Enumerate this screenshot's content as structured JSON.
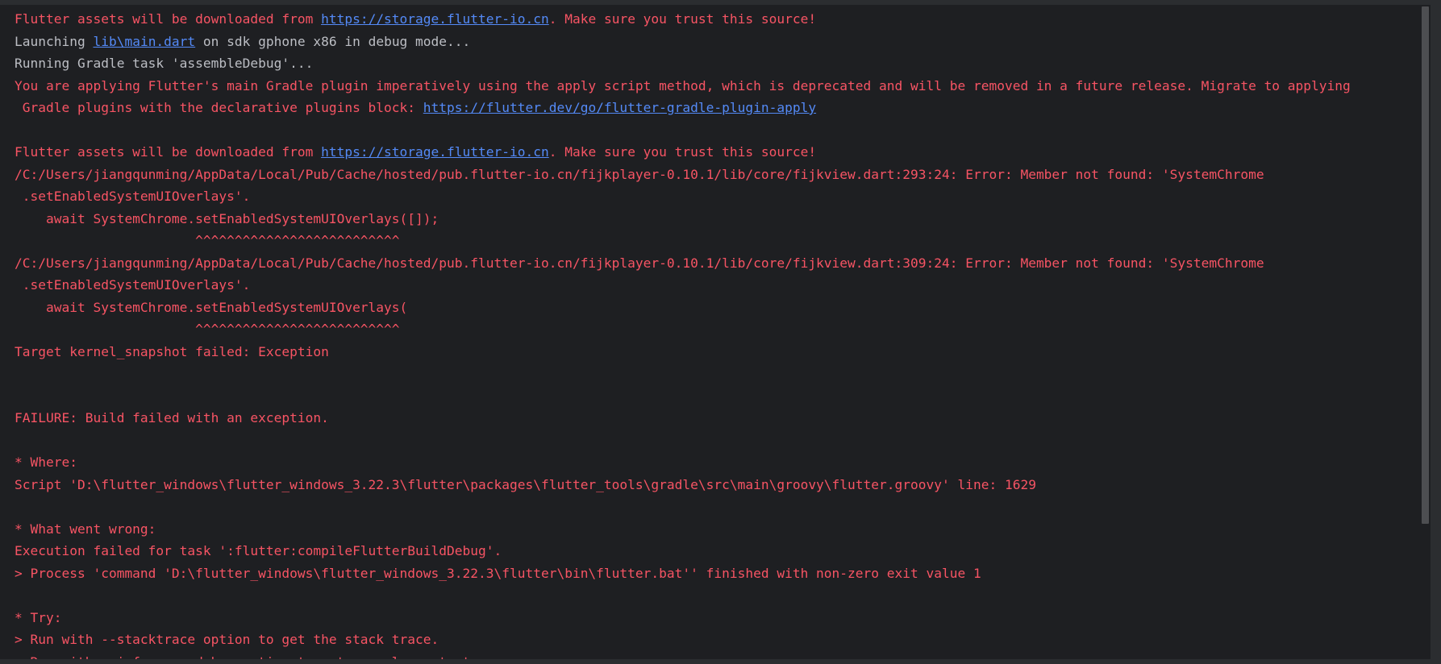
{
  "console": {
    "lines": [
      {
        "parts": [
          {
            "text": "Flutter assets will be downloaded from ",
            "style": "err"
          },
          {
            "text": "https://storage.flutter-io.cn",
            "style": "link"
          },
          {
            "text": ". Make sure you trust this source!",
            "style": "err"
          }
        ]
      },
      {
        "parts": [
          {
            "text": "Launching ",
            "style": "norm"
          },
          {
            "text": "lib\\main.dart",
            "style": "link"
          },
          {
            "text": " on sdk gphone x86 in debug mode...",
            "style": "norm"
          }
        ]
      },
      {
        "parts": [
          {
            "text": "Running Gradle task 'assembleDebug'...",
            "style": "norm"
          }
        ]
      },
      {
        "parts": [
          {
            "text": "You are applying Flutter's main Gradle plugin imperatively using the apply script method, which is deprecated and will be removed in a future release. Migrate to applying",
            "style": "err"
          }
        ]
      },
      {
        "parts": [
          {
            "text": " Gradle plugins with the declarative plugins block: ",
            "style": "err"
          },
          {
            "text": "https://flutter.dev/go/flutter-gradle-plugin-apply",
            "style": "link"
          }
        ]
      },
      {
        "parts": []
      },
      {
        "parts": [
          {
            "text": "Flutter assets will be downloaded from ",
            "style": "err"
          },
          {
            "text": "https://storage.flutter-io.cn",
            "style": "link"
          },
          {
            "text": ". Make sure you trust this source!",
            "style": "err"
          }
        ]
      },
      {
        "parts": [
          {
            "text": "/C:/Users/jiangqunming/AppData/Local/Pub/Cache/hosted/pub.flutter-io.cn/fijkplayer-0.10.1/lib/core/fijkview.dart:293:24: Error: Member not found: 'SystemChrome",
            "style": "err"
          }
        ]
      },
      {
        "parts": [
          {
            "text": " .setEnabledSystemUIOverlays'.",
            "style": "err"
          }
        ]
      },
      {
        "parts": [
          {
            "text": "    await SystemChrome.setEnabledSystemUIOverlays([]);",
            "style": "err"
          }
        ]
      },
      {
        "parts": [
          {
            "text": "                       ^^^^^^^^^^^^^^^^^^^^^^^^^^",
            "style": "err"
          }
        ]
      },
      {
        "parts": [
          {
            "text": "/C:/Users/jiangqunming/AppData/Local/Pub/Cache/hosted/pub.flutter-io.cn/fijkplayer-0.10.1/lib/core/fijkview.dart:309:24: Error: Member not found: 'SystemChrome",
            "style": "err"
          }
        ]
      },
      {
        "parts": [
          {
            "text": " .setEnabledSystemUIOverlays'.",
            "style": "err"
          }
        ]
      },
      {
        "parts": [
          {
            "text": "    await SystemChrome.setEnabledSystemUIOverlays(",
            "style": "err"
          }
        ]
      },
      {
        "parts": [
          {
            "text": "                       ^^^^^^^^^^^^^^^^^^^^^^^^^^",
            "style": "err"
          }
        ]
      },
      {
        "parts": [
          {
            "text": "Target kernel_snapshot failed: Exception",
            "style": "err"
          }
        ]
      },
      {
        "parts": []
      },
      {
        "parts": []
      },
      {
        "parts": [
          {
            "text": "FAILURE: Build failed with an exception.",
            "style": "err"
          }
        ]
      },
      {
        "parts": []
      },
      {
        "parts": [
          {
            "text": "* Where:",
            "style": "err"
          }
        ]
      },
      {
        "parts": [
          {
            "text": "Script 'D:\\flutter_windows\\flutter_windows_3.22.3\\flutter\\packages\\flutter_tools\\gradle\\src\\main\\groovy\\flutter.groovy' line: 1629",
            "style": "err"
          }
        ]
      },
      {
        "parts": []
      },
      {
        "parts": [
          {
            "text": "* What went wrong:",
            "style": "err"
          }
        ]
      },
      {
        "parts": [
          {
            "text": "Execution failed for task ':flutter:compileFlutterBuildDebug'.",
            "style": "err"
          }
        ]
      },
      {
        "parts": [
          {
            "text": "> Process 'command 'D:\\flutter_windows\\flutter_windows_3.22.3\\flutter\\bin\\flutter.bat'' finished with non-zero exit value 1",
            "style": "err"
          }
        ]
      },
      {
        "parts": []
      },
      {
        "parts": [
          {
            "text": "* Try:",
            "style": "err"
          }
        ]
      },
      {
        "parts": [
          {
            "text": "> Run with --stacktrace option to get the stack trace.",
            "style": "err"
          }
        ]
      },
      {
        "parts": [
          {
            "text": "> Run with --info or --debug option to get more log output.",
            "style": "err"
          }
        ]
      }
    ]
  },
  "colors": {
    "background": "#1e1f22",
    "error": "#f75464",
    "normal": "#bcbec4",
    "link": "#548af7"
  }
}
